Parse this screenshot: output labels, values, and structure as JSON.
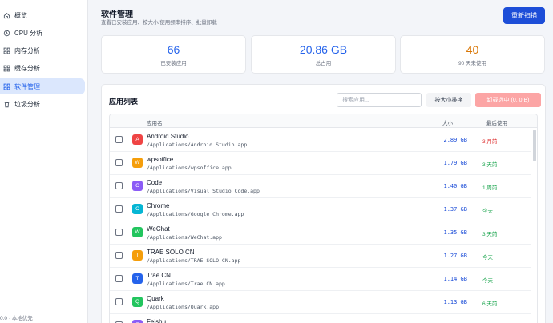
{
  "sidebar": {
    "items": [
      {
        "label": "概览",
        "icon": "home-icon",
        "active": false
      },
      {
        "label": "CPU 分析",
        "icon": "cpu-icon",
        "active": false
      },
      {
        "label": "内存分析",
        "icon": "memory-icon",
        "active": false
      },
      {
        "label": "缓存分析",
        "icon": "cache-icon",
        "active": false
      },
      {
        "label": "软件管理",
        "icon": "apps-icon",
        "active": true
      },
      {
        "label": "垃圾分析",
        "icon": "trash-icon",
        "active": false
      }
    ],
    "footer": "0.0 · 本地优先"
  },
  "header": {
    "title": "软件管理",
    "subtitle": "查看已安装应用、按大小/使用频率排序、批量卸载",
    "rescan_label": "重新扫描"
  },
  "stats": [
    {
      "value": "66",
      "caption": "已安装应用",
      "color": "#2563eb"
    },
    {
      "value": "20.86 GB",
      "caption": "总占用",
      "color": "#2563eb"
    },
    {
      "value": "40",
      "caption": "90 天未使用",
      "color": "#d97706"
    }
  ],
  "list": {
    "title": "应用列表",
    "search_placeholder": "搜索应用...",
    "sort_label": "按大小排序",
    "uninstall_label": "卸载选中 (0, 0 B)",
    "columns": {
      "name": "应用名",
      "size": "大小",
      "last_used": "最后使用"
    },
    "rows": [
      {
        "letter": "A",
        "color": "#ef4444",
        "name": "Android Studio",
        "path": "/Applications/Android Studio.app",
        "size": "2.89 GB",
        "last": "3 月前",
        "last_color": "#dc2626"
      },
      {
        "letter": "W",
        "color": "#f59e0b",
        "name": "wpsoffice",
        "path": "/Applications/wpsoffice.app",
        "size": "1.79 GB",
        "last": "3 天前",
        "last_color": "#16a34a"
      },
      {
        "letter": "C",
        "color": "#8b5cf6",
        "name": "Code",
        "path": "/Applications/Visual Studio Code.app",
        "size": "1.40 GB",
        "last": "1 周前",
        "last_color": "#16a34a"
      },
      {
        "letter": "C",
        "color": "#06b6d4",
        "name": "Chrome",
        "path": "/Applications/Google Chrome.app",
        "size": "1.37 GB",
        "last": "今天",
        "last_color": "#16a34a"
      },
      {
        "letter": "W",
        "color": "#22c55e",
        "name": "WeChat",
        "path": "/Applications/WeChat.app",
        "size": "1.35 GB",
        "last": "3 天前",
        "last_color": "#16a34a"
      },
      {
        "letter": "T",
        "color": "#f59e0b",
        "name": "TRAE SOLO CN",
        "path": "/Applications/TRAE SOLO CN.app",
        "size": "1.27 GB",
        "last": "今天",
        "last_color": "#16a34a"
      },
      {
        "letter": "T",
        "color": "#2563eb",
        "name": "Trae CN",
        "path": "/Applications/Trae CN.app",
        "size": "1.14 GB",
        "last": "今天",
        "last_color": "#16a34a"
      },
      {
        "letter": "Q",
        "color": "#22c55e",
        "name": "Quark",
        "path": "/Applications/Quark.app",
        "size": "1.13 GB",
        "last": "6 天前",
        "last_color": "#16a34a"
      },
      {
        "letter": "F",
        "color": "#8b5cf6",
        "name": "Feishu",
        "path": "",
        "size": "",
        "last": "",
        "last_color": "#16a34a"
      }
    ]
  }
}
